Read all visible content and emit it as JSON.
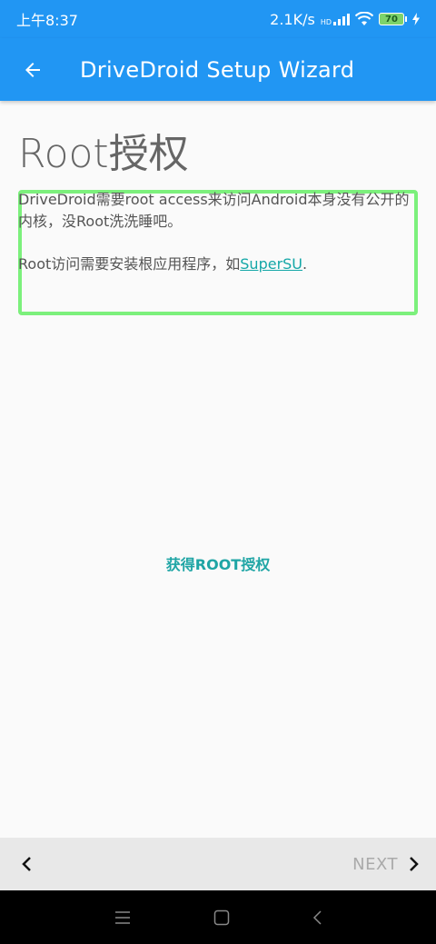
{
  "status": {
    "time": "上午8:37",
    "speed": "2.1K/s",
    "network_badge": "HD",
    "battery": "70"
  },
  "appbar": {
    "title": "DriveDroid Setup Wizard"
  },
  "page": {
    "title": "Root授权",
    "paragraph1": "DriveDroid需要root access来访问Android本身没有公开的内核，没Root洗洗睡吧。",
    "paragraph2_prefix": "Root访问需要安装根应用程序，如",
    "paragraph2_link": "SuperSU",
    "paragraph2_suffix": ".",
    "root_button": "获得ROOT授权"
  },
  "bottom": {
    "next_label": "NEXT"
  },
  "colors": {
    "primary": "#2196f3",
    "accent": "#1fa5a5",
    "highlight": "#7cf07c"
  }
}
